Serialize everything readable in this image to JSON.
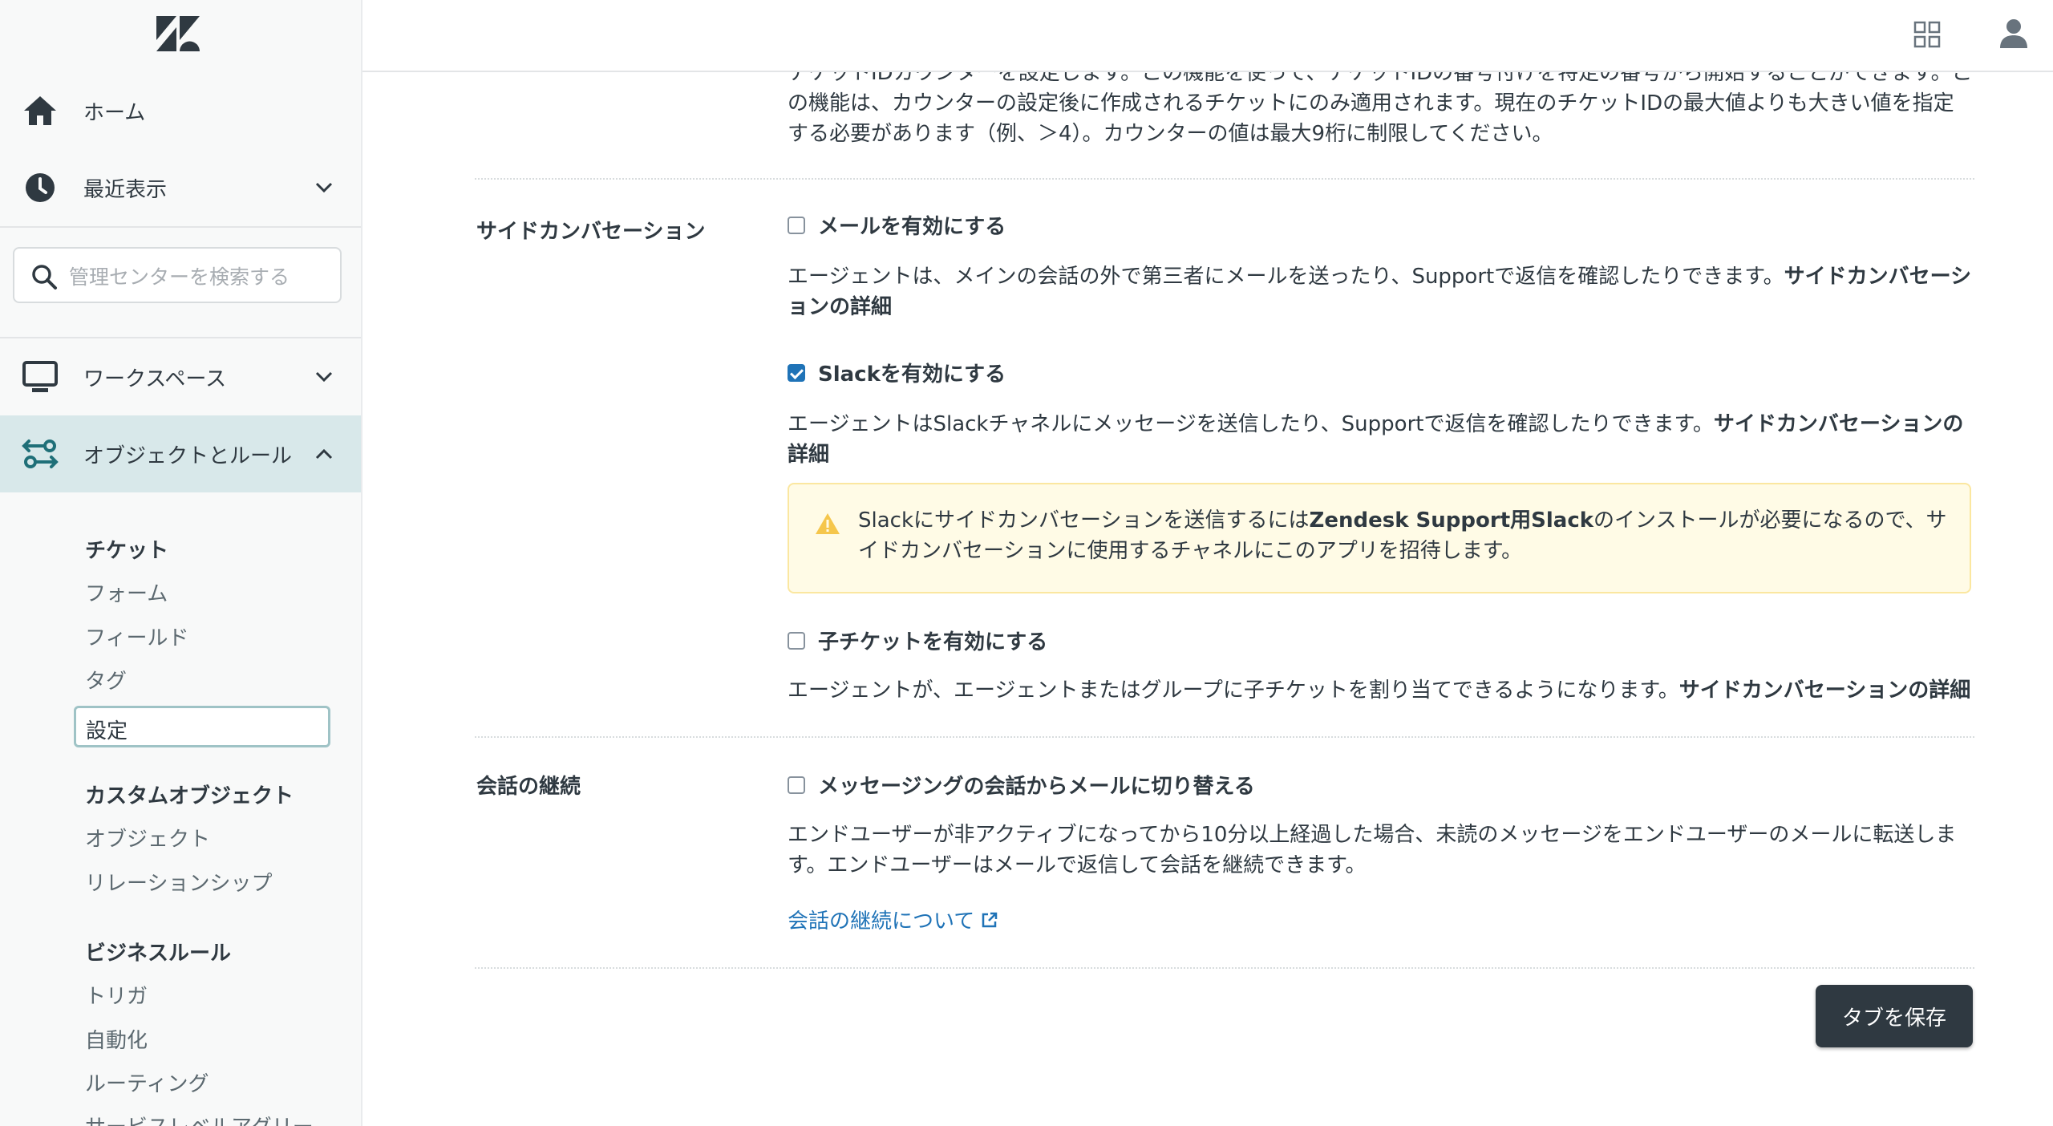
{
  "colors": {
    "accent": "#1f73b7",
    "active_bg": "#d8e8ea",
    "notice_bg": "#fffbe6",
    "warning": "#f5c64c",
    "button_bg": "#2f3941"
  },
  "sidebar": {
    "home": "ホーム",
    "recent": "最近表示",
    "search_placeholder": "管理センターを検索する",
    "workspace": "ワークスペース",
    "objects_rules": "オブジェクトとルール",
    "tickets_group": {
      "heading": "チケット",
      "items": [
        "フォーム",
        "フィールド",
        "タグ"
      ],
      "selected": "設定"
    },
    "custom_objects_group": {
      "heading": "カスタムオブジェクト",
      "items": [
        "オブジェクト",
        "リレーションシップ"
      ]
    },
    "business_rules_group": {
      "heading": "ビジネスルール",
      "items": [
        "トリガ",
        "自動化",
        "ルーティング",
        "サービスレベルアグリー"
      ]
    }
  },
  "content": {
    "intro_lines": [
      "チケットIDカウンターを設定します。この機能を使って、チケットIDの番号付けを特定の番号から開始することができます。こ",
      "の機能は、カウンターの設定後に作成されるチケットにのみ適用されます。現在のチケットIDの最大値よりも大きい値を指定",
      "する必要があります（例、＞4）。カウンターの値は最大9桁に制限してください。"
    ],
    "side_conversations": {
      "label": "サイドカンバセーション",
      "email": {
        "checked": false,
        "label": "メールを有効にする",
        "desc": "エージェントは、メインの会話の外で第三者にメールを送ったり、Supportで返信を確認したりできます。",
        "more": "サイドカンバセーションの詳細"
      },
      "slack": {
        "checked": true,
        "label": "Slackを有効にする",
        "desc": "エージェントはSlackチャネルにメッセージを送信したり、Supportで返信を確認したりできます。",
        "more": "サイドカンバセーションの詳細"
      },
      "notice": {
        "before": "Slackにサイドカンバセーションを送信するには",
        "strong": "Zendesk Support用Slack",
        "after": "のインストールが必要になるので、サイドカンバセーションに使用するチャネルにこのアプリを招待します。"
      },
      "child_ticket": {
        "checked": false,
        "label": "子チケットを有効にする",
        "desc": "エージェントが、エージェントまたはグループに子チケットを割り当てできるようになります。",
        "more": "サイドカンバセーションの詳細"
      }
    },
    "conversation_continuation": {
      "label": "会話の継続",
      "switch": {
        "checked": false,
        "label": "メッセージングの会話からメールに切り替える",
        "desc": "エンドユーザーが非アクティブになってから10分以上経過した場合、未読のメッセージをエンドユーザーのメールに転送します。エンドユーザーはメールで返信して会話を継続できます。"
      },
      "link": "会話の継続について"
    },
    "save_button": "タブを保存"
  }
}
